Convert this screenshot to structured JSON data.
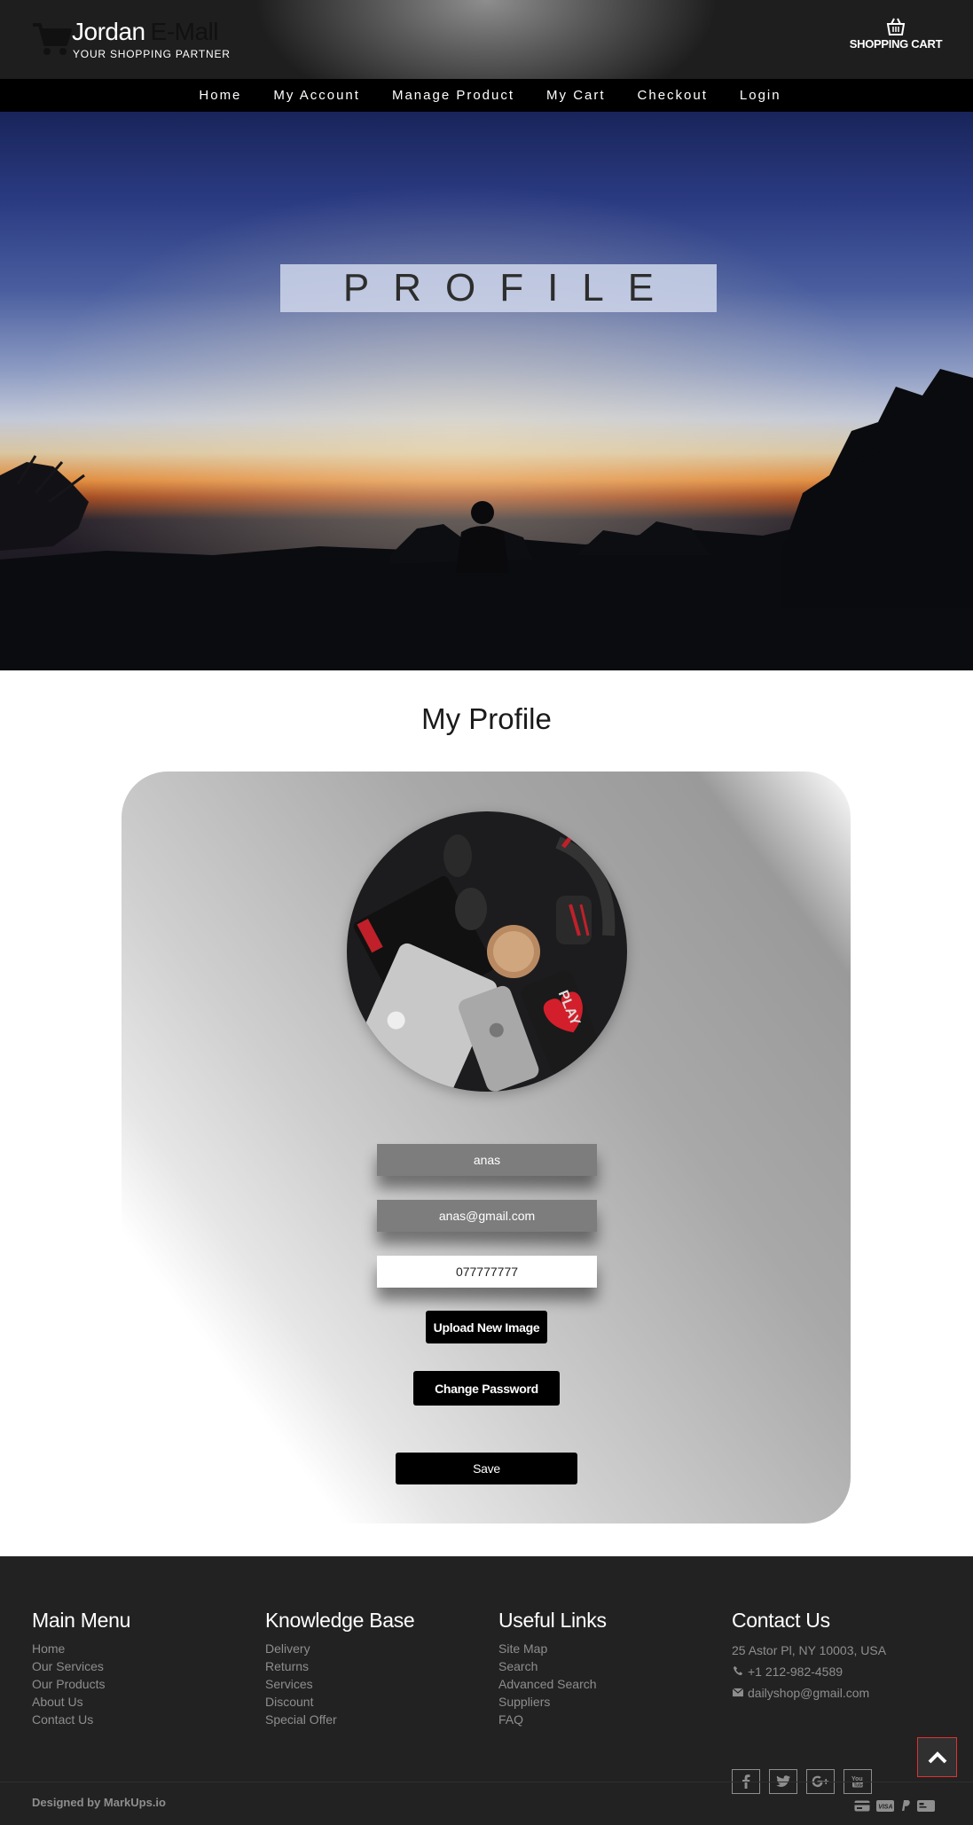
{
  "header": {
    "brand_primary": "Jordan",
    "brand_secondary": "E-Mall",
    "tagline": "YOUR SHOPPING PARTNER",
    "cart_label": "SHOPPING CART",
    "cart_icon": "basket-icon",
    "logo_icon": "shopping-cart-icon"
  },
  "nav": {
    "items": [
      {
        "label": "Home"
      },
      {
        "label": "My Account"
      },
      {
        "label": "Manage Product"
      },
      {
        "label": "My Cart"
      },
      {
        "label": "Checkout"
      },
      {
        "label": "Login"
      }
    ]
  },
  "hero": {
    "title": "PROFILE"
  },
  "main": {
    "title": "My Profile",
    "username": "anas",
    "email": "anas@gmail.com",
    "phone": "077777777",
    "upload_label": "Upload New Image",
    "change_password_label": "Change Password",
    "save_label": "Save"
  },
  "footer": {
    "columns": [
      {
        "heading": "Main Menu",
        "links": [
          "Home",
          "Our Services",
          "Our Products",
          "About Us",
          "Contact Us"
        ]
      },
      {
        "heading": "Knowledge Base",
        "links": [
          "Delivery",
          "Returns",
          "Services",
          "Discount",
          "Special Offer"
        ]
      },
      {
        "heading": "Useful Links",
        "links": [
          "Site Map",
          "Search",
          "Advanced Search",
          "Suppliers",
          "FAQ"
        ]
      }
    ],
    "contact": {
      "heading": "Contact Us",
      "address": "25 Astor Pl, NY 10003, USA",
      "phone": "+1 212-982-4589",
      "email": "dailyshop@gmail.com"
    },
    "social_icons": [
      "facebook-icon",
      "twitter-icon",
      "google-plus-icon",
      "youtube-icon"
    ],
    "designed_by": "Designed by MarkUps.io",
    "payment_icons": [
      "credit-card-icon",
      "visa-icon",
      "paypal-icon",
      "card-icon"
    ]
  },
  "colors": {
    "nav_bg": "#000000",
    "footer_bg": "#222222",
    "button_bg": "#000000",
    "field_grey": "#7d7d7d",
    "scroll_top_border": "#dd3333"
  }
}
